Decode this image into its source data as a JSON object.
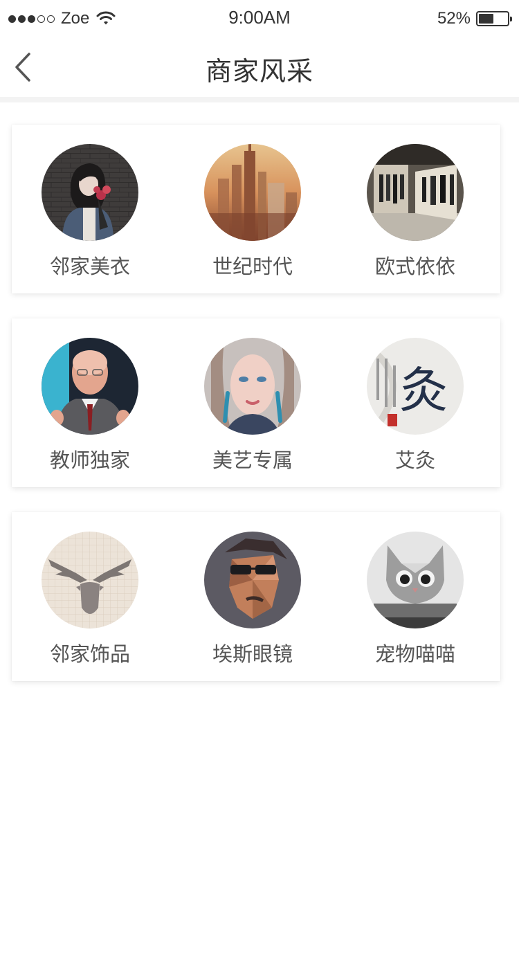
{
  "status_bar": {
    "carrier": "Zoe",
    "time": "9:00AM",
    "battery_percent": "52%",
    "battery_level": 0.52,
    "signal_strength": 3,
    "signal_max": 5
  },
  "nav": {
    "title": "商家风采",
    "back_icon": "chevron-left-icon"
  },
  "merchants": [
    {
      "name": "邻家美衣"
    },
    {
      "name": "世纪时代"
    },
    {
      "name": "欧式依依"
    },
    {
      "name": "教师独家"
    },
    {
      "name": "美艺专属"
    },
    {
      "name": "艾灸"
    },
    {
      "name": "邻家饰品"
    },
    {
      "name": "埃斯眼镜"
    },
    {
      "name": "宠物喵喵"
    }
  ],
  "avatar_art_text": {
    "moxibustion_calligraphy": "灸"
  }
}
